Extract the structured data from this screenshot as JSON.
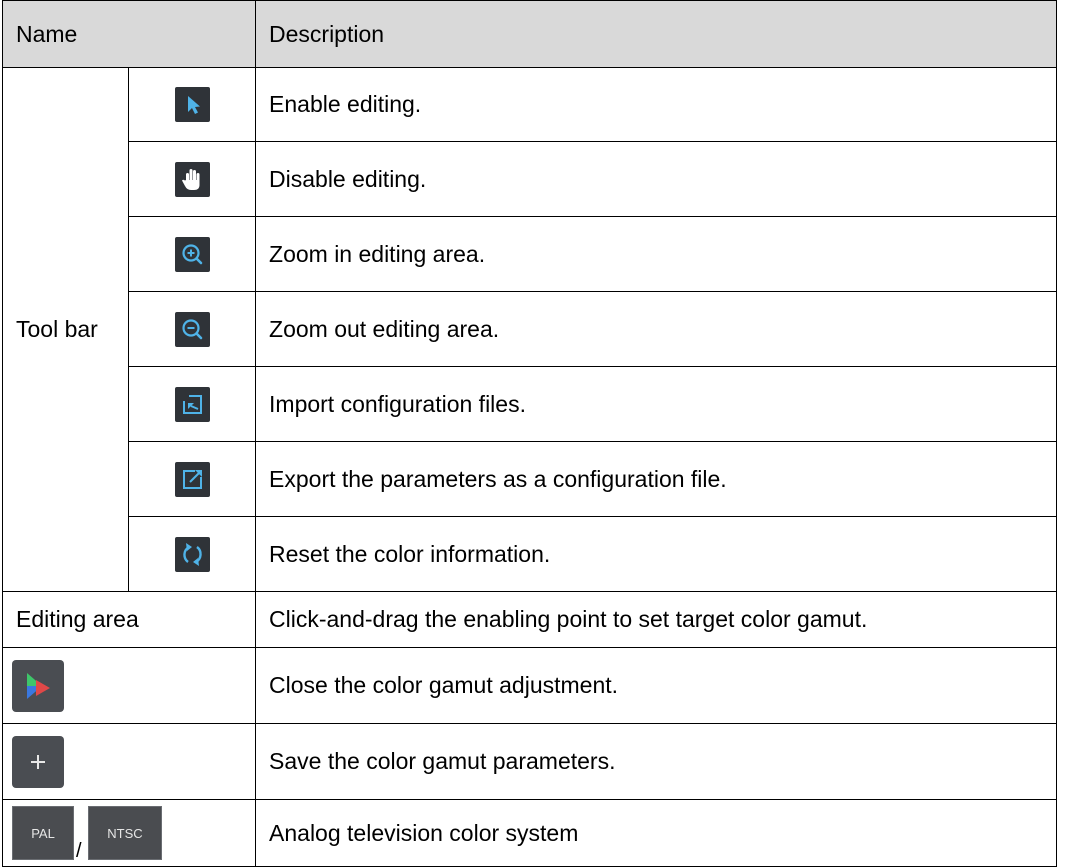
{
  "header": {
    "name": "Name",
    "description": "Description"
  },
  "toolbar": {
    "label": "Tool bar",
    "items": [
      {
        "icon": "pointer-arrow-icon",
        "description": "Enable editing."
      },
      {
        "icon": "hand-icon",
        "description": "Disable editing."
      },
      {
        "icon": "zoom-in-icon",
        "description": "Zoom in editing area."
      },
      {
        "icon": "zoom-out-icon",
        "description": "Zoom out editing area."
      },
      {
        "icon": "import-icon",
        "description": "Import configuration files."
      },
      {
        "icon": "export-icon",
        "description": "Export the parameters as a configuration file."
      },
      {
        "icon": "reset-icon",
        "description": "Reset the color information."
      }
    ]
  },
  "editing_area": {
    "name": "Editing area",
    "description": "Click-and-drag the enabling point to set target color gamut."
  },
  "gamut_toggle": {
    "icon": "color-gamut-icon",
    "description": "Close the color gamut adjustment."
  },
  "save": {
    "icon": "plus-icon",
    "description": "Save the color gamut parameters."
  },
  "analog": {
    "pal_label": "PAL",
    "separator": "/",
    "ntsc_label": "NTSC",
    "description": "Analog television color system"
  },
  "colors": {
    "header_bg": "#d9d9d9",
    "icon_bg": "#2f3338",
    "icon_accent": "#4fb3e8"
  }
}
